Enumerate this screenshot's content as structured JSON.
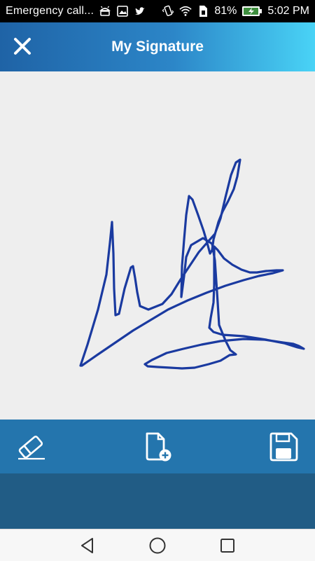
{
  "status_bar": {
    "carrier_text": "Emergency call...",
    "battery_percent": "81%",
    "time": "5:02 PM",
    "icons_left": [
      "android-icon",
      "image-icon",
      "twitter-icon"
    ],
    "icons_right": [
      "vibrate-icon",
      "wifi-icon",
      "sim-icon",
      "battery-charging-icon"
    ]
  },
  "app_bar": {
    "title": "My Signature",
    "close_icon": "close-icon",
    "gradient_colors": [
      "#1f63a6",
      "#49d3f6"
    ]
  },
  "signature": {
    "stroke_color": "#1a3aa0",
    "background_color": "#eeeeee"
  },
  "toolbar": {
    "background_color": "#2475ad",
    "buttons": [
      {
        "icon": "eraser-icon"
      },
      {
        "icon": "new-document-icon"
      },
      {
        "icon": "save-icon"
      }
    ]
  },
  "nav_bar": {
    "buttons": [
      {
        "icon": "back-icon"
      },
      {
        "icon": "home-icon"
      },
      {
        "icon": "recents-icon"
      }
    ]
  }
}
